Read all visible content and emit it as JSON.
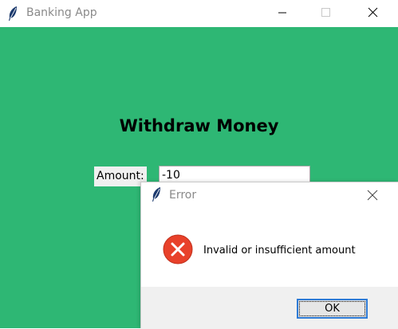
{
  "window": {
    "title": "Banking App",
    "icon": "feather-icon"
  },
  "main": {
    "heading": "Withdraw Money",
    "amount_label": "Amount:",
    "amount_value": "-10"
  },
  "dialog": {
    "title": "Error",
    "icon": "error-icon",
    "message": "Invalid or insufficient amount",
    "ok_label": "OK"
  },
  "colors": {
    "background": "#2eb774",
    "error_red": "#e8412a",
    "ok_border": "#2e7bd6"
  }
}
